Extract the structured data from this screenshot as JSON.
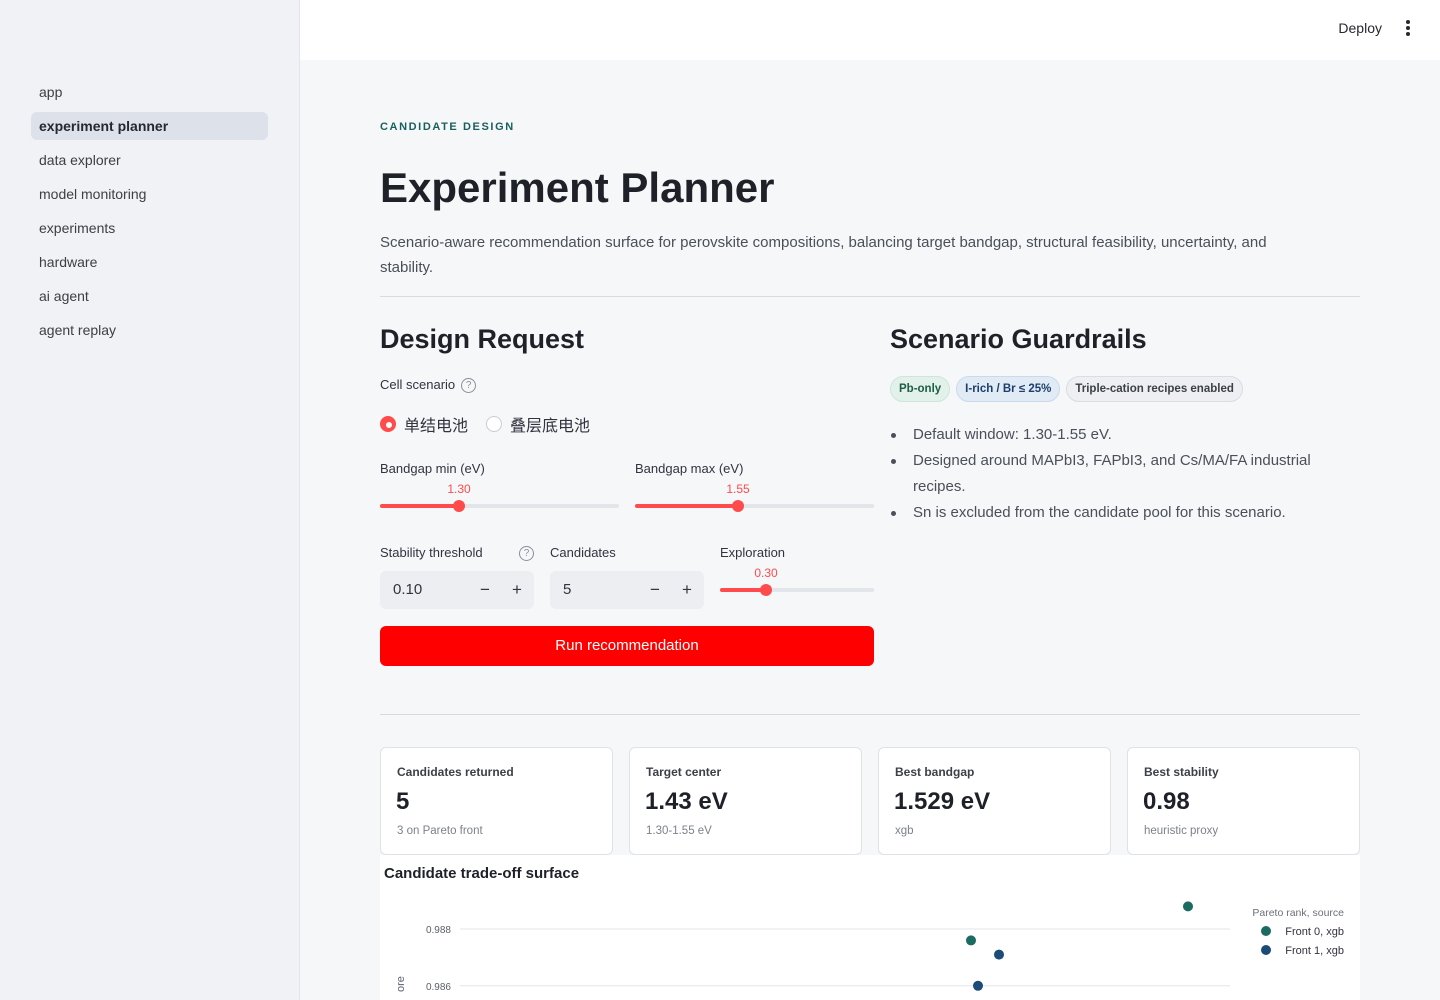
{
  "sidebar": {
    "items": [
      {
        "label": "app",
        "active": false
      },
      {
        "label": "experiment planner",
        "active": true
      },
      {
        "label": "data explorer",
        "active": false
      },
      {
        "label": "model monitoring",
        "active": false
      },
      {
        "label": "experiments",
        "active": false
      },
      {
        "label": "hardware",
        "active": false
      },
      {
        "label": "ai agent",
        "active": false
      },
      {
        "label": "agent replay",
        "active": false
      }
    ]
  },
  "header": {
    "deploy_label": "Deploy",
    "menu_icon": "kebab-menu-icon"
  },
  "page": {
    "eyebrow": "CANDIDATE DESIGN",
    "title": "Experiment Planner",
    "description": "Scenario-aware recommendation surface for perovskite compositions, balancing target bandgap, structural feasibility, uncertainty, and stability."
  },
  "design_request": {
    "heading": "Design Request",
    "cell_scenario": {
      "label": "Cell scenario",
      "help_icon": "question-circle-icon",
      "options": [
        "单结电池",
        "叠层底电池"
      ],
      "selected": "单结电池"
    },
    "bandgap_min": {
      "label": "Bandgap min (eV)",
      "value": "1.30",
      "fraction": 0.33
    },
    "bandgap_max": {
      "label": "Bandgap max (eV)",
      "value": "1.55",
      "fraction": 0.43
    },
    "stability": {
      "label": "Stability threshold",
      "value": "0.10",
      "minus": "−",
      "plus": "+",
      "help_icon": "question-circle-icon"
    },
    "candidates": {
      "label": "Candidates",
      "value": "5",
      "minus": "−",
      "plus": "+"
    },
    "exploration": {
      "label": "Exploration",
      "value": "0.30",
      "fraction": 0.3
    },
    "run_label": "Run recommendation"
  },
  "guardrails": {
    "heading": "Scenario Guardrails",
    "chips": [
      {
        "label": "Pb-only",
        "tone": "green"
      },
      {
        "label": "I-rich / Br ≤ 25%",
        "tone": "blue"
      },
      {
        "label": "Triple-cation recipes enabled",
        "tone": "gray"
      }
    ],
    "bullets": [
      "Default window: 1.30-1.55 eV.",
      "Designed around MAPbI3, FAPbI3, and Cs/MA/FA industrial recipes.",
      "Sn is excluded from the candidate pool for this scenario."
    ]
  },
  "metrics": [
    {
      "label": "Candidates returned",
      "value": "5",
      "sub": "3 on Pareto front"
    },
    {
      "label": "Target center",
      "value": "1.43 eV",
      "sub": "1.30-1.55 eV"
    },
    {
      "label": "Best bandgap",
      "value": "1.529 eV",
      "sub": "xgb"
    },
    {
      "label": "Best stability",
      "value": "0.98",
      "sub": "heuristic proxy"
    }
  ],
  "chart_data": {
    "type": "scatter",
    "title": "Candidate trade-off surface",
    "ylabel": "ore",
    "y_ticks": [
      "0.988",
      "0.986"
    ],
    "legend_title": "Pareto rank, source",
    "legend_position": "top-right",
    "series": [
      {
        "name": "Front 0, xgb",
        "color": "#1b6b63",
        "points": [
          [
            0.73,
            0.9876
          ],
          [
            1.04,
            0.9888
          ]
        ]
      },
      {
        "name": "Front 1, xgb",
        "color": "#1d4b78",
        "points": [
          [
            0.77,
            0.9871
          ],
          [
            0.74,
            0.986
          ]
        ]
      }
    ],
    "x_domain": [
      0,
      1.1
    ],
    "y_range": [
      0.9855,
      0.9892
    ],
    "grid": true
  }
}
